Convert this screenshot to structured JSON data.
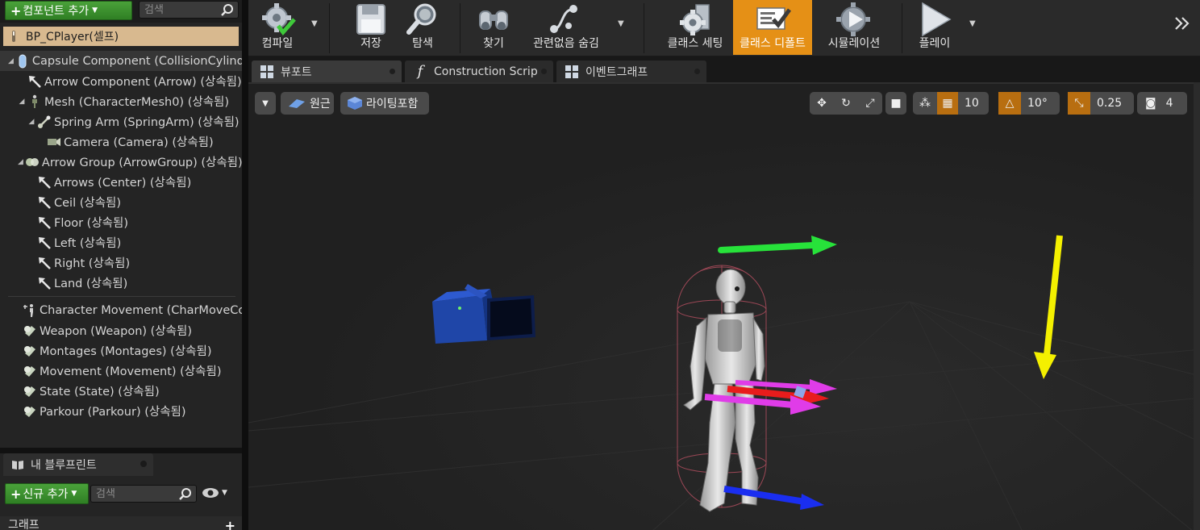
{
  "components_panel": {
    "add_button": "컴포넌트 추가",
    "search_placeholder": "검색",
    "self_row": "BP_CPlayer(셀프)",
    "tree": [
      {
        "label": "Capsule Component (CollisionCylinder)",
        "indent": 0,
        "expanded": true,
        "icon": "capsule-icon",
        "selected": true
      },
      {
        "label": "Arrow Component (Arrow) (상속됨)",
        "indent": 1,
        "icon": "arrow-component-icon"
      },
      {
        "label": "Mesh (CharacterMesh0) (상속됨)",
        "indent": 1,
        "expanded": true,
        "icon": "skeletal-mesh-icon"
      },
      {
        "label": "Spring Arm (SpringArm) (상속됨)",
        "indent": 2,
        "expanded": true,
        "icon": "spring-arm-icon"
      },
      {
        "label": "Camera (Camera) (상속됨)",
        "indent": 3,
        "icon": "camera-icon"
      },
      {
        "label": "Arrow Group (ArrowGroup) (상속됨)",
        "indent": 1,
        "expanded": true,
        "icon": "scene-component-icon"
      },
      {
        "label": "Arrows (Center) (상속됨)",
        "indent": 2,
        "icon": "arrow-component-icon"
      },
      {
        "label": "Ceil (상속됨)",
        "indent": 2,
        "icon": "arrow-component-icon"
      },
      {
        "label": "Floor (상속됨)",
        "indent": 2,
        "icon": "arrow-component-icon"
      },
      {
        "label": "Left (상속됨)",
        "indent": 2,
        "icon": "arrow-component-icon"
      },
      {
        "label": "Right (상속됨)",
        "indent": 2,
        "icon": "arrow-component-icon"
      },
      {
        "label": "Land (상속됨)",
        "indent": 2,
        "icon": "arrow-component-icon"
      }
    ],
    "actor_components": [
      {
        "label": "Character Movement (CharMoveComp)",
        "icon": "character-movement-icon"
      },
      {
        "label": "Weapon (Weapon) (상속됨)",
        "icon": "actor-component-icon"
      },
      {
        "label": "Montages (Montages) (상속됨)",
        "icon": "actor-component-icon"
      },
      {
        "label": "Movement (Movement) (상속됨)",
        "icon": "actor-component-icon"
      },
      {
        "label": "State (State) (상속됨)",
        "icon": "actor-component-icon"
      },
      {
        "label": "Parkour (Parkour) (상속됨)",
        "icon": "actor-component-icon"
      }
    ]
  },
  "my_blueprint": {
    "tab_label": "내 블루프린트",
    "add_new_button": "신규 추가",
    "search_placeholder": "검색",
    "section_graph": "그래프"
  },
  "toolbar": {
    "compile": "컴파일",
    "save": "저장",
    "browse": "탐색",
    "find": "찾기",
    "hide_unrelated": "관련없음 숨김",
    "class_settings": "클래스 세팅",
    "class_defaults": "클래스 디폴트",
    "simulation": "시뮬레이션",
    "play": "플레이"
  },
  "tabs": {
    "viewport": "뷰포트",
    "construction_script": "Construction Script",
    "event_graph": "이벤트그래프"
  },
  "viewport_toolbar": {
    "perspective": "원근",
    "lit": "라이팅포함",
    "grid_snap": "10",
    "rotation_snap": "10°",
    "scale_snap": "0.25",
    "camera_speed": "4"
  },
  "colors": {
    "accent_orange": "#e59016",
    "selected_row": "#d8b98f",
    "green_button": "#3c8f2e",
    "arrow_green": "#27e23a",
    "arrow_yellow": "#f4f000",
    "arrow_magenta": "#e03ce8",
    "arrow_red": "#e81c1c",
    "arrow_blue": "#1a2ef0"
  }
}
